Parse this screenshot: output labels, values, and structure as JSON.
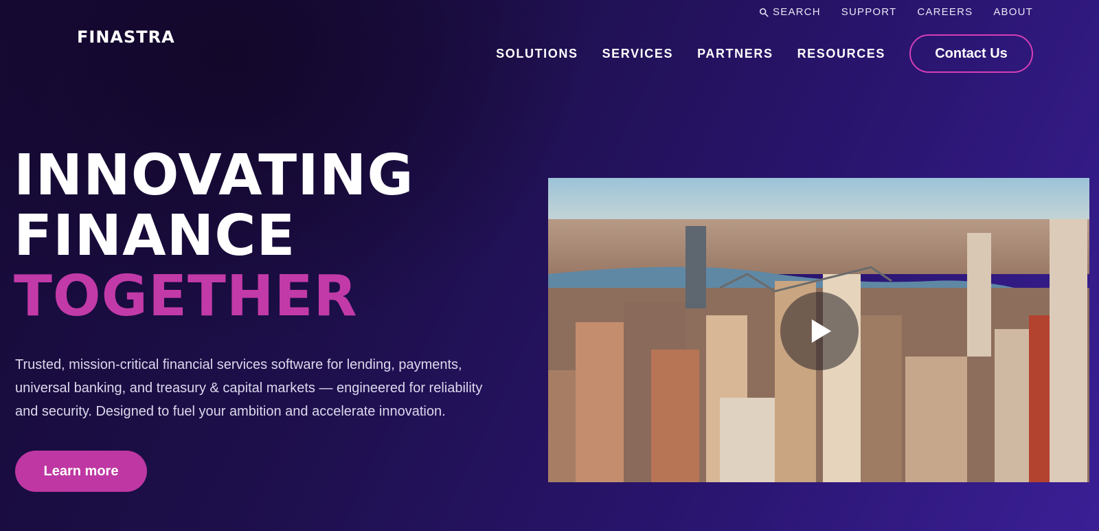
{
  "brand": {
    "logo_text": "FINASTRA"
  },
  "utility_nav": {
    "search": {
      "label": "SEARCH",
      "icon": "search-icon"
    },
    "items": [
      "SUPPORT",
      "CAREERS",
      "ABOUT"
    ]
  },
  "main_nav": {
    "items": [
      "SOLUTIONS",
      "SERVICES",
      "PARTNERS",
      "RESOURCES"
    ],
    "contact_label": "Contact Us"
  },
  "hero": {
    "title_line1": "INNOVATING",
    "title_line2": "FINANCE",
    "title_line3": "TOGETHER",
    "description": "Trusted, mission-critical financial services software for lending, payments, universal banking, and treasury & capital markets — engineered for reliability and security. Designed to fuel your ambition and accelerate innovation.",
    "cta_label": "Learn more"
  },
  "video": {
    "play_icon": "play-icon"
  },
  "colors": {
    "accent_magenta": "#c23aa8",
    "button_magenta": "#be37a3",
    "contact_border": "#d53fb6",
    "background_dark": "#160a36",
    "background_purple": "#3a1f95"
  }
}
